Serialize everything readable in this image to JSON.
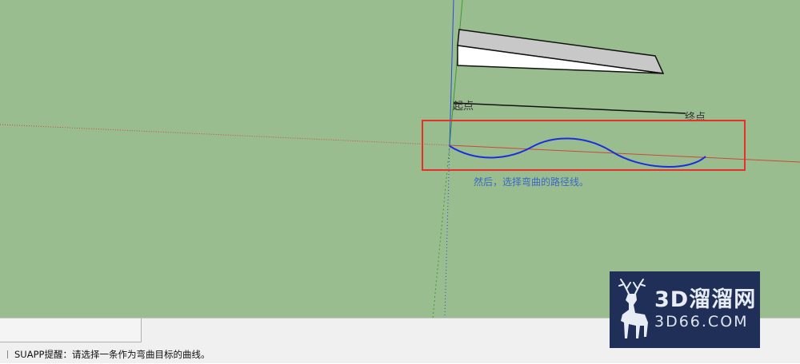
{
  "scene": {
    "label_start": "起点",
    "label_end": "终点",
    "instruction": "然后，选择弯曲的路径线。"
  },
  "status_bar": {
    "message": "SUAPP提醒：请选择一条作为弯曲目标的曲线。"
  },
  "watermark": {
    "line1": "3D溜溜网",
    "line2": "3D66.COM"
  },
  "colors": {
    "viewport_background": "#9abd8f",
    "highlight_box": "#e8302a",
    "curve": "#1a2ee0",
    "instruction_text": "#3a68c8",
    "red_axis": "#c84a3a",
    "green_axis": "#3a9a3a",
    "blue_axis": "#2a4ad8",
    "watermark_bg": "#1f2f57"
  }
}
